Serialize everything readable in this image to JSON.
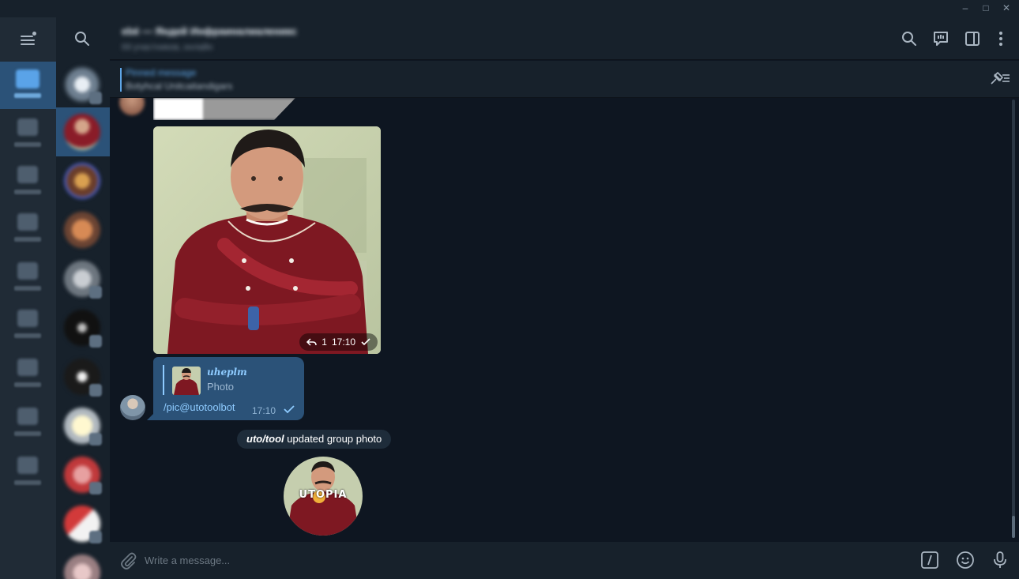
{
  "window": {
    "minimize": "–",
    "maximize": "□",
    "close": "✕"
  },
  "header": {
    "title": "ebé — Яндей Инфраиналиаленикс",
    "subtitle": "69 участников, онлайн"
  },
  "pinned": {
    "title": "Pinned message",
    "text": "Botyhcal  Unitcaitandigars"
  },
  "photo_message": {
    "replies": "1",
    "time": "17:10"
  },
  "reply_message": {
    "reply_to_name": "uheplm",
    "reply_to_type": "Photo",
    "text": "/pic@utotoolbot",
    "time": "17:10"
  },
  "service": {
    "actor": "uto/tool",
    "action": " updated group photo"
  },
  "group_photo": {
    "overlay_text": "UTOPIA"
  },
  "composer": {
    "placeholder": "Write a message..."
  },
  "colors": {
    "accent": "#5ea6e8",
    "bubble_out": "#2b5278",
    "background": "#0e1621",
    "panel": "#17212b"
  },
  "icons": {
    "menu": "hamburger-icon",
    "search": "search-icon",
    "attach": "paperclip-icon",
    "commands": "slash-command-icon",
    "emoji": "emoji-icon",
    "voice": "microphone-icon"
  }
}
